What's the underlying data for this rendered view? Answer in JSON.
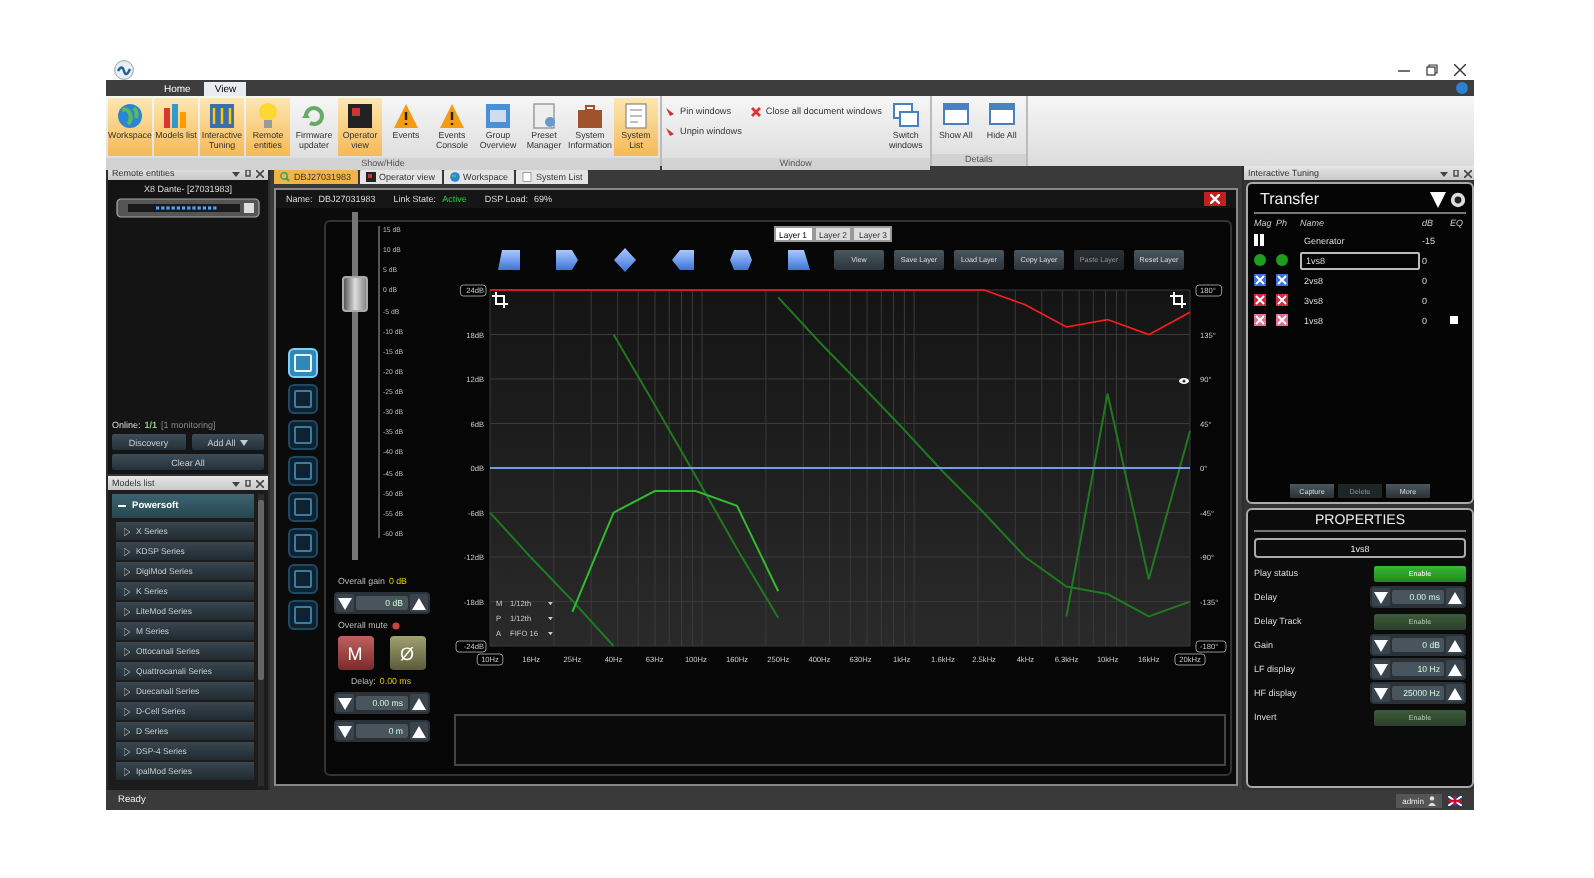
{
  "ribbon": {
    "tabs": [
      {
        "label": "Home",
        "selected": false
      },
      {
        "label": "View",
        "selected": true
      }
    ],
    "groups": [
      {
        "title": "Show/Hide",
        "items": [
          {
            "kind": "large",
            "label": "Workspace",
            "on": true
          },
          {
            "kind": "large",
            "label": "Models list",
            "on": true
          },
          {
            "kind": "large",
            "label": "Interactive Tuning",
            "on": true
          },
          {
            "kind": "large",
            "label": "Remote entities",
            "on": true
          },
          {
            "kind": "large",
            "label": "Firmware updater",
            "on": false
          },
          {
            "kind": "large",
            "label": "Operator view",
            "on": true
          },
          {
            "kind": "large",
            "label": "Events",
            "on": false
          },
          {
            "kind": "large",
            "label": "Events Console",
            "on": false
          },
          {
            "kind": "large",
            "label": "Group Overview",
            "on": false
          },
          {
            "kind": "large",
            "label": "Preset Manager",
            "on": false
          },
          {
            "kind": "large",
            "label": "System Information",
            "on": false
          },
          {
            "kind": "large",
            "label": "System List",
            "on": true
          }
        ]
      },
      {
        "title": "Window",
        "items": [
          {
            "kind": "small",
            "label": "Pin windows"
          },
          {
            "kind": "small",
            "label": "Unpin windows"
          },
          {
            "kind": "small",
            "label": "Close all document windows"
          },
          {
            "kind": "large",
            "label": "Switch windows",
            "on": false
          }
        ]
      },
      {
        "title": "Details",
        "items": [
          {
            "kind": "large",
            "label": "Show All",
            "on": false
          },
          {
            "kind": "large",
            "label": "Hide All",
            "on": false
          }
        ]
      }
    ]
  },
  "remote_entities": {
    "title": "Remote entities",
    "device": "X8 Dante- [27031983]",
    "online_label": "Online:",
    "online_count": "1/1",
    "monitoring": "[1 monitoring]",
    "buttons": [
      "Discovery",
      "Add All",
      "Clear All"
    ]
  },
  "models_list": {
    "title": "Models list",
    "root": {
      "label": "Powersoft",
      "expanded": true,
      "children": [
        {
          "label": "X Series"
        },
        {
          "label": "KDSP Series"
        },
        {
          "label": "DigiMod Series"
        },
        {
          "label": "K Series"
        },
        {
          "label": "LiteMod Series"
        },
        {
          "label": "M Series"
        },
        {
          "label": "Ottocanali Series"
        },
        {
          "label": "Quattrocanali Series"
        },
        {
          "label": "Duecanali Series"
        },
        {
          "label": "D-Cell Series"
        },
        {
          "label": "D Series"
        },
        {
          "label": "DSP-4 Series"
        },
        {
          "label": "IpalMod Series"
        }
      ]
    }
  },
  "document_tabs": [
    {
      "label": "DBJ27031983",
      "selected": true
    },
    {
      "label": "Operator view",
      "selected": false
    },
    {
      "label": "Workspace",
      "selected": false
    },
    {
      "label": "System List",
      "selected": false
    }
  ],
  "device_bar": {
    "name_label": "Name:",
    "name": "DBJ27031983",
    "link_label": "Link State:",
    "link_state": "Active",
    "dsp_label": "DSP Load:",
    "dsp_load": "69%"
  },
  "channel_tools": [
    {
      "selected": true
    },
    {
      "selected": false
    },
    {
      "selected": false
    },
    {
      "selected": false
    },
    {
      "selected": false
    },
    {
      "selected": false
    },
    {
      "selected": false
    },
    {
      "selected": false
    }
  ],
  "fader": {
    "scale": [
      "15 dB",
      "10 dB",
      "5 dB",
      "0 dB",
      "-5 dB",
      "-10 dB",
      "-15 dB",
      "-20 dB",
      "-25 dB",
      "-30 dB",
      "-35 dB",
      "-40 dB",
      "-45 dB",
      "-50 dB",
      "-55 dB",
      "-60 dB"
    ],
    "level": 0.8
  },
  "gain": {
    "label": "Overall gain",
    "value": "0 dB",
    "field": "0 dB"
  },
  "mute": {
    "label": "Overall mute",
    "mute_button": "M",
    "phase_button": "Ø"
  },
  "delay": {
    "label": "Delay:",
    "value": "0.00 ms",
    "fields": [
      "0.00 ms",
      "0 m"
    ]
  },
  "layers": [
    {
      "label": "Layer 1",
      "selected": true
    },
    {
      "label": "Layer 2",
      "selected": false
    },
    {
      "label": "Layer 3",
      "selected": false
    }
  ],
  "layer_buttons": [
    {
      "label": "View",
      "disabled": false
    },
    {
      "label": "Save Layer",
      "disabled": false
    },
    {
      "label": "Load Layer",
      "disabled": false
    },
    {
      "label": "Copy Layer",
      "disabled": false
    },
    {
      "label": "Paste Layer",
      "disabled": true
    },
    {
      "label": "Reset Layer",
      "disabled": false
    }
  ],
  "chart": {
    "chart_data": {
      "type": "line",
      "categories": [
        "10Hz",
        "16Hz",
        "25Hz",
        "40Hz",
        "63Hz",
        "100Hz",
        "160Hz",
        "250Hz",
        "400Hz",
        "630Hz",
        "1kHz",
        "1.6kHz",
        "2.5kHz",
        "4kHz",
        "6.3kHz",
        "10kHz",
        "16kHz",
        "20kHz"
      ],
      "grid": true,
      "ylim": [
        -24,
        24
      ],
      "yticks": [
        {
          "value": 24,
          "label": "24dB"
        },
        {
          "value": 18,
          "label": "18dB"
        },
        {
          "value": 12,
          "label": "12dB"
        },
        {
          "value": 6,
          "label": "6dB"
        },
        {
          "value": 0,
          "label": "0dB"
        },
        {
          "value": -6,
          "label": "-6dB"
        },
        {
          "value": -12,
          "label": "-12dB"
        },
        {
          "value": -18,
          "label": "-18dB"
        },
        {
          "value": -24,
          "label": "-24dB"
        }
      ],
      "series": [
        {
          "color": "#1f7a1f",
          "values": [
            -6,
            -12.1,
            -17.9,
            -24,
            null,
            null,
            null,
            null,
            null,
            null,
            null,
            null,
            null,
            null,
            null,
            null,
            null,
            null
          ]
        },
        {
          "color": "#1f7a1f",
          "values": [
            null,
            null,
            null,
            18,
            8.5,
            -1.1,
            -10.9,
            -20.2,
            null,
            null,
            null,
            null,
            null,
            null,
            null,
            null,
            null,
            null
          ]
        },
        {
          "color": "#1f7a1f",
          "values": [
            null,
            null,
            null,
            null,
            null,
            null,
            null,
            23,
            17,
            11.3,
            5.5,
            -0.5,
            -6.1,
            -12,
            -16,
            -17,
            -20,
            -18
          ]
        },
        {
          "color": "#1f7a1f",
          "values": [
            null,
            null,
            null,
            null,
            null,
            null,
            null,
            null,
            null,
            null,
            null,
            null,
            null,
            null,
            -20,
            10,
            -15,
            5
          ]
        },
        {
          "color": "#2ebd2e",
          "values": [
            null,
            null,
            -19.4,
            -6,
            -3.1,
            -3.1,
            -5.1,
            -16.6,
            null,
            null,
            null,
            null,
            null,
            null,
            null,
            null,
            null,
            null
          ]
        },
        {
          "color": "#6f9fe8",
          "values": [
            0,
            0,
            0,
            0,
            0,
            0,
            0,
            0,
            0,
            0,
            0,
            0,
            0,
            0,
            0,
            0,
            0,
            0
          ]
        },
        {
          "color": "#ff1e1e",
          "values": [
            24,
            24,
            24,
            24,
            24,
            24,
            24,
            24,
            24,
            24,
            24,
            24,
            24,
            22,
            19,
            20,
            18,
            21
          ]
        }
      ]
    },
    "phase_labels": [
      "180°",
      "135°",
      "90°",
      "45°",
      "0°",
      "-45°",
      "-90°",
      "-135°",
      "-180°"
    ],
    "smoothing": [
      {
        "key": "M",
        "value": "1/12th"
      },
      {
        "key": "P",
        "value": "1/12th"
      },
      {
        "key": "A",
        "value": "FIFO 16"
      }
    ]
  },
  "tuning": {
    "title": "Interactive Tuning",
    "transfer": "Transfer",
    "columns": [
      "Mag",
      "Ph",
      "Name",
      "dB",
      "EQ"
    ],
    "rows": [
      {
        "kind": "generator",
        "name": "Generator",
        "db": "-15"
      },
      {
        "kind": "trace",
        "name": "1vs8",
        "db": "0",
        "color": "#1e9e1e",
        "visible": true,
        "editing": true
      },
      {
        "kind": "trace",
        "name": "2vs8",
        "db": "0",
        "color": "#3b6fe0",
        "visible": false,
        "editing": false
      },
      {
        "kind": "trace",
        "name": "3vs8",
        "db": "0",
        "color": "#d22a3e",
        "visible": false,
        "editing": false
      },
      {
        "kind": "trace",
        "name": "1vs8",
        "db": "0",
        "color": "#e0709a",
        "visible": false,
        "editing": false,
        "eq_checked": false
      }
    ],
    "buttons": [
      {
        "label": "Capture",
        "disabled": false
      },
      {
        "label": "Delete",
        "disabled": true
      },
      {
        "label": "More",
        "disabled": false
      }
    ]
  },
  "properties": {
    "title": "PROPERTIES",
    "selection": "1vs8",
    "rows": [
      {
        "label": "Play status",
        "kind": "toggle",
        "value": "Enable",
        "on": true
      },
      {
        "label": "Delay",
        "kind": "spin",
        "value": "0.00 ms"
      },
      {
        "label": "Delay Track",
        "kind": "toggle",
        "value": "Enable",
        "on": false
      },
      {
        "label": "Gain",
        "kind": "spin",
        "value": "0 dB"
      },
      {
        "label": "LF display",
        "kind": "spin",
        "value": "10 Hz"
      },
      {
        "label": "HF display",
        "kind": "spin",
        "value": "25000 Hz"
      },
      {
        "label": "Invert",
        "kind": "toggle",
        "value": "Enable",
        "on": false
      }
    ]
  },
  "status_bar": {
    "text": "Ready",
    "user": "admin"
  }
}
